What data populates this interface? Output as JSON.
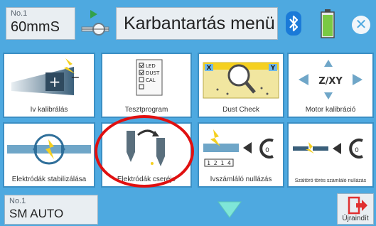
{
  "header": {
    "program_no": "No.1",
    "program_name": "60mmS",
    "title": "Karbantartás menü"
  },
  "icons": {
    "program_change": "splice-program-icon",
    "bluetooth": "bluetooth-icon",
    "battery": "battery-icon",
    "close": "close-icon",
    "scroll_down": "chevron-down-icon",
    "restart": "restart-icon"
  },
  "tiles": [
    {
      "label": "Ív kalibrálás",
      "icon": "arc-calibration-icon"
    },
    {
      "label": "Tesztprogram",
      "icon": "test-program-icon",
      "checklist": [
        "LED",
        "DUST",
        "CAL"
      ]
    },
    {
      "label": "Dust Check",
      "icon": "dust-check-icon",
      "x_label": "X",
      "y_label": "Y"
    },
    {
      "label": "Motor kalibráció",
      "icon": "motor-calibration-icon",
      "axis_label": "Z/XY"
    },
    {
      "label": "Elektródák stabilizálása",
      "icon": "electrode-stabilize-icon"
    },
    {
      "label": "Elektródák cseréje",
      "icon": "electrode-replace-icon"
    },
    {
      "label": "Ívszámláló nullázás",
      "icon": "arc-counter-reset-icon",
      "counter": "1 2 1 4",
      "reset_value": "0"
    },
    {
      "label": "Száltörő törés számláló nullázás",
      "icon": "cleaver-counter-reset-icon",
      "reset_value": "0"
    }
  ],
  "footer": {
    "mode_no": "No.1",
    "mode_name": "SM AUTO",
    "restart_label": "Újraindít"
  },
  "colors": {
    "background": "#4ea9e0",
    "highlight": "#e01010",
    "accent_yellow": "#f5d020",
    "bluetooth": "#1a7ad8",
    "battery": "#7ac943"
  }
}
